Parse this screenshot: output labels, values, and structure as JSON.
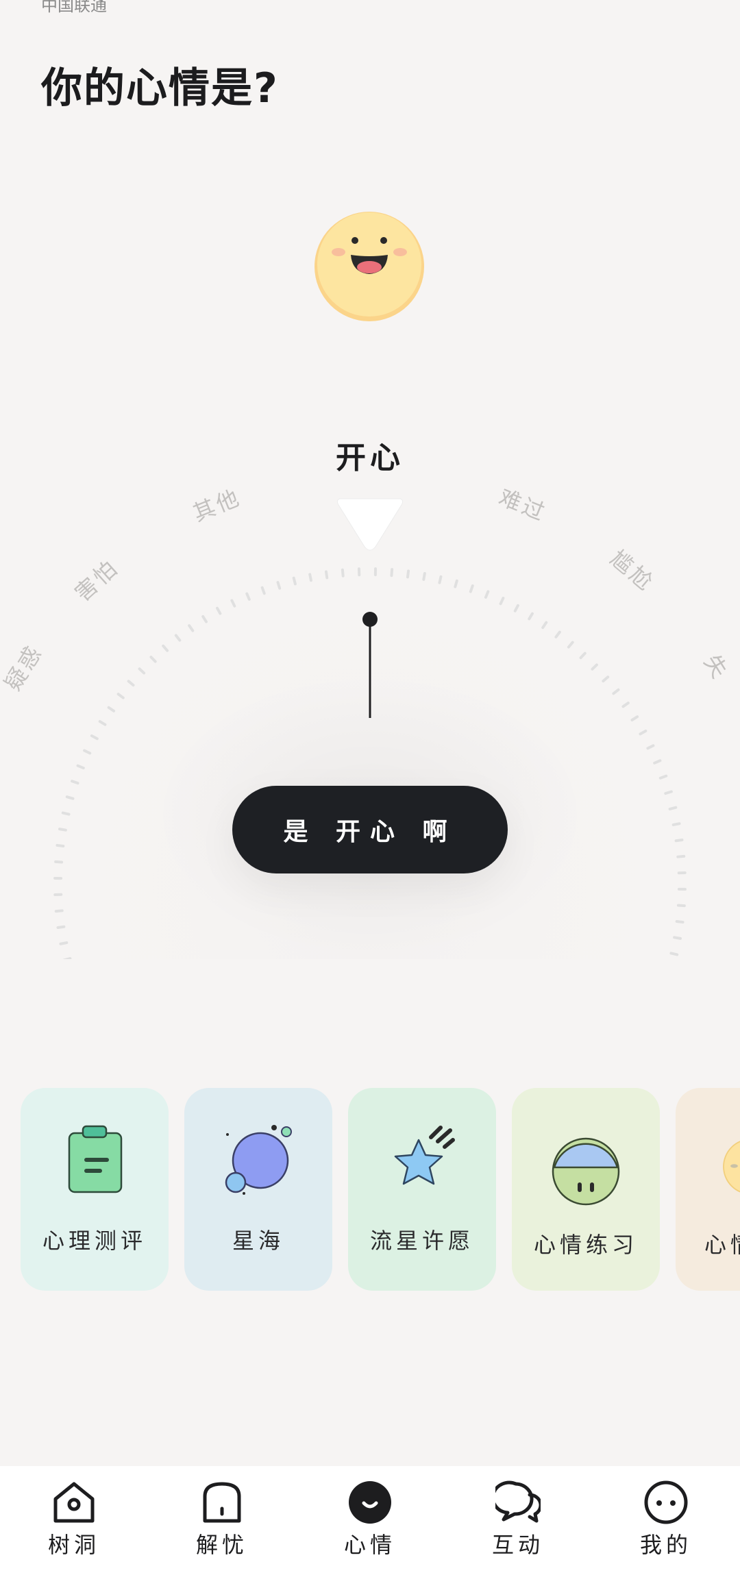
{
  "status_snippet": "中国联通",
  "page_title": "你的心情是?",
  "current_mood": "开心",
  "confirm_label": "是 开心 啊",
  "wheel_moods": [
    "疑惑",
    "害怕",
    "其他",
    "难过",
    "尴尬",
    "失"
  ],
  "cards": [
    {
      "label": "心理测评",
      "icon": "clipboard-icon",
      "bg": "#e2f3ef"
    },
    {
      "label": "星海",
      "icon": "planet-icon",
      "bg": "#dfecf1"
    },
    {
      "label": "流星许愿",
      "icon": "shooting-star-icon",
      "bg": "#dcf1e3"
    },
    {
      "label": "心情练习",
      "icon": "mood-face-icon",
      "bg": "#eaf2dc"
    },
    {
      "label": "心情",
      "icon": "emoji-icon",
      "bg": "#f5ebde"
    }
  ],
  "tabs": [
    {
      "label": "树洞",
      "icon": "tree-hole-icon"
    },
    {
      "label": "解忧",
      "icon": "door-icon"
    },
    {
      "label": "心情",
      "icon": "mood-icon",
      "active": true
    },
    {
      "label": "互动",
      "icon": "chat-icon"
    },
    {
      "label": "我的",
      "icon": "profile-icon"
    }
  ],
  "colors": {
    "background": "#f6f4f3",
    "button": "#1e2024",
    "emoji": "#fde08a"
  }
}
